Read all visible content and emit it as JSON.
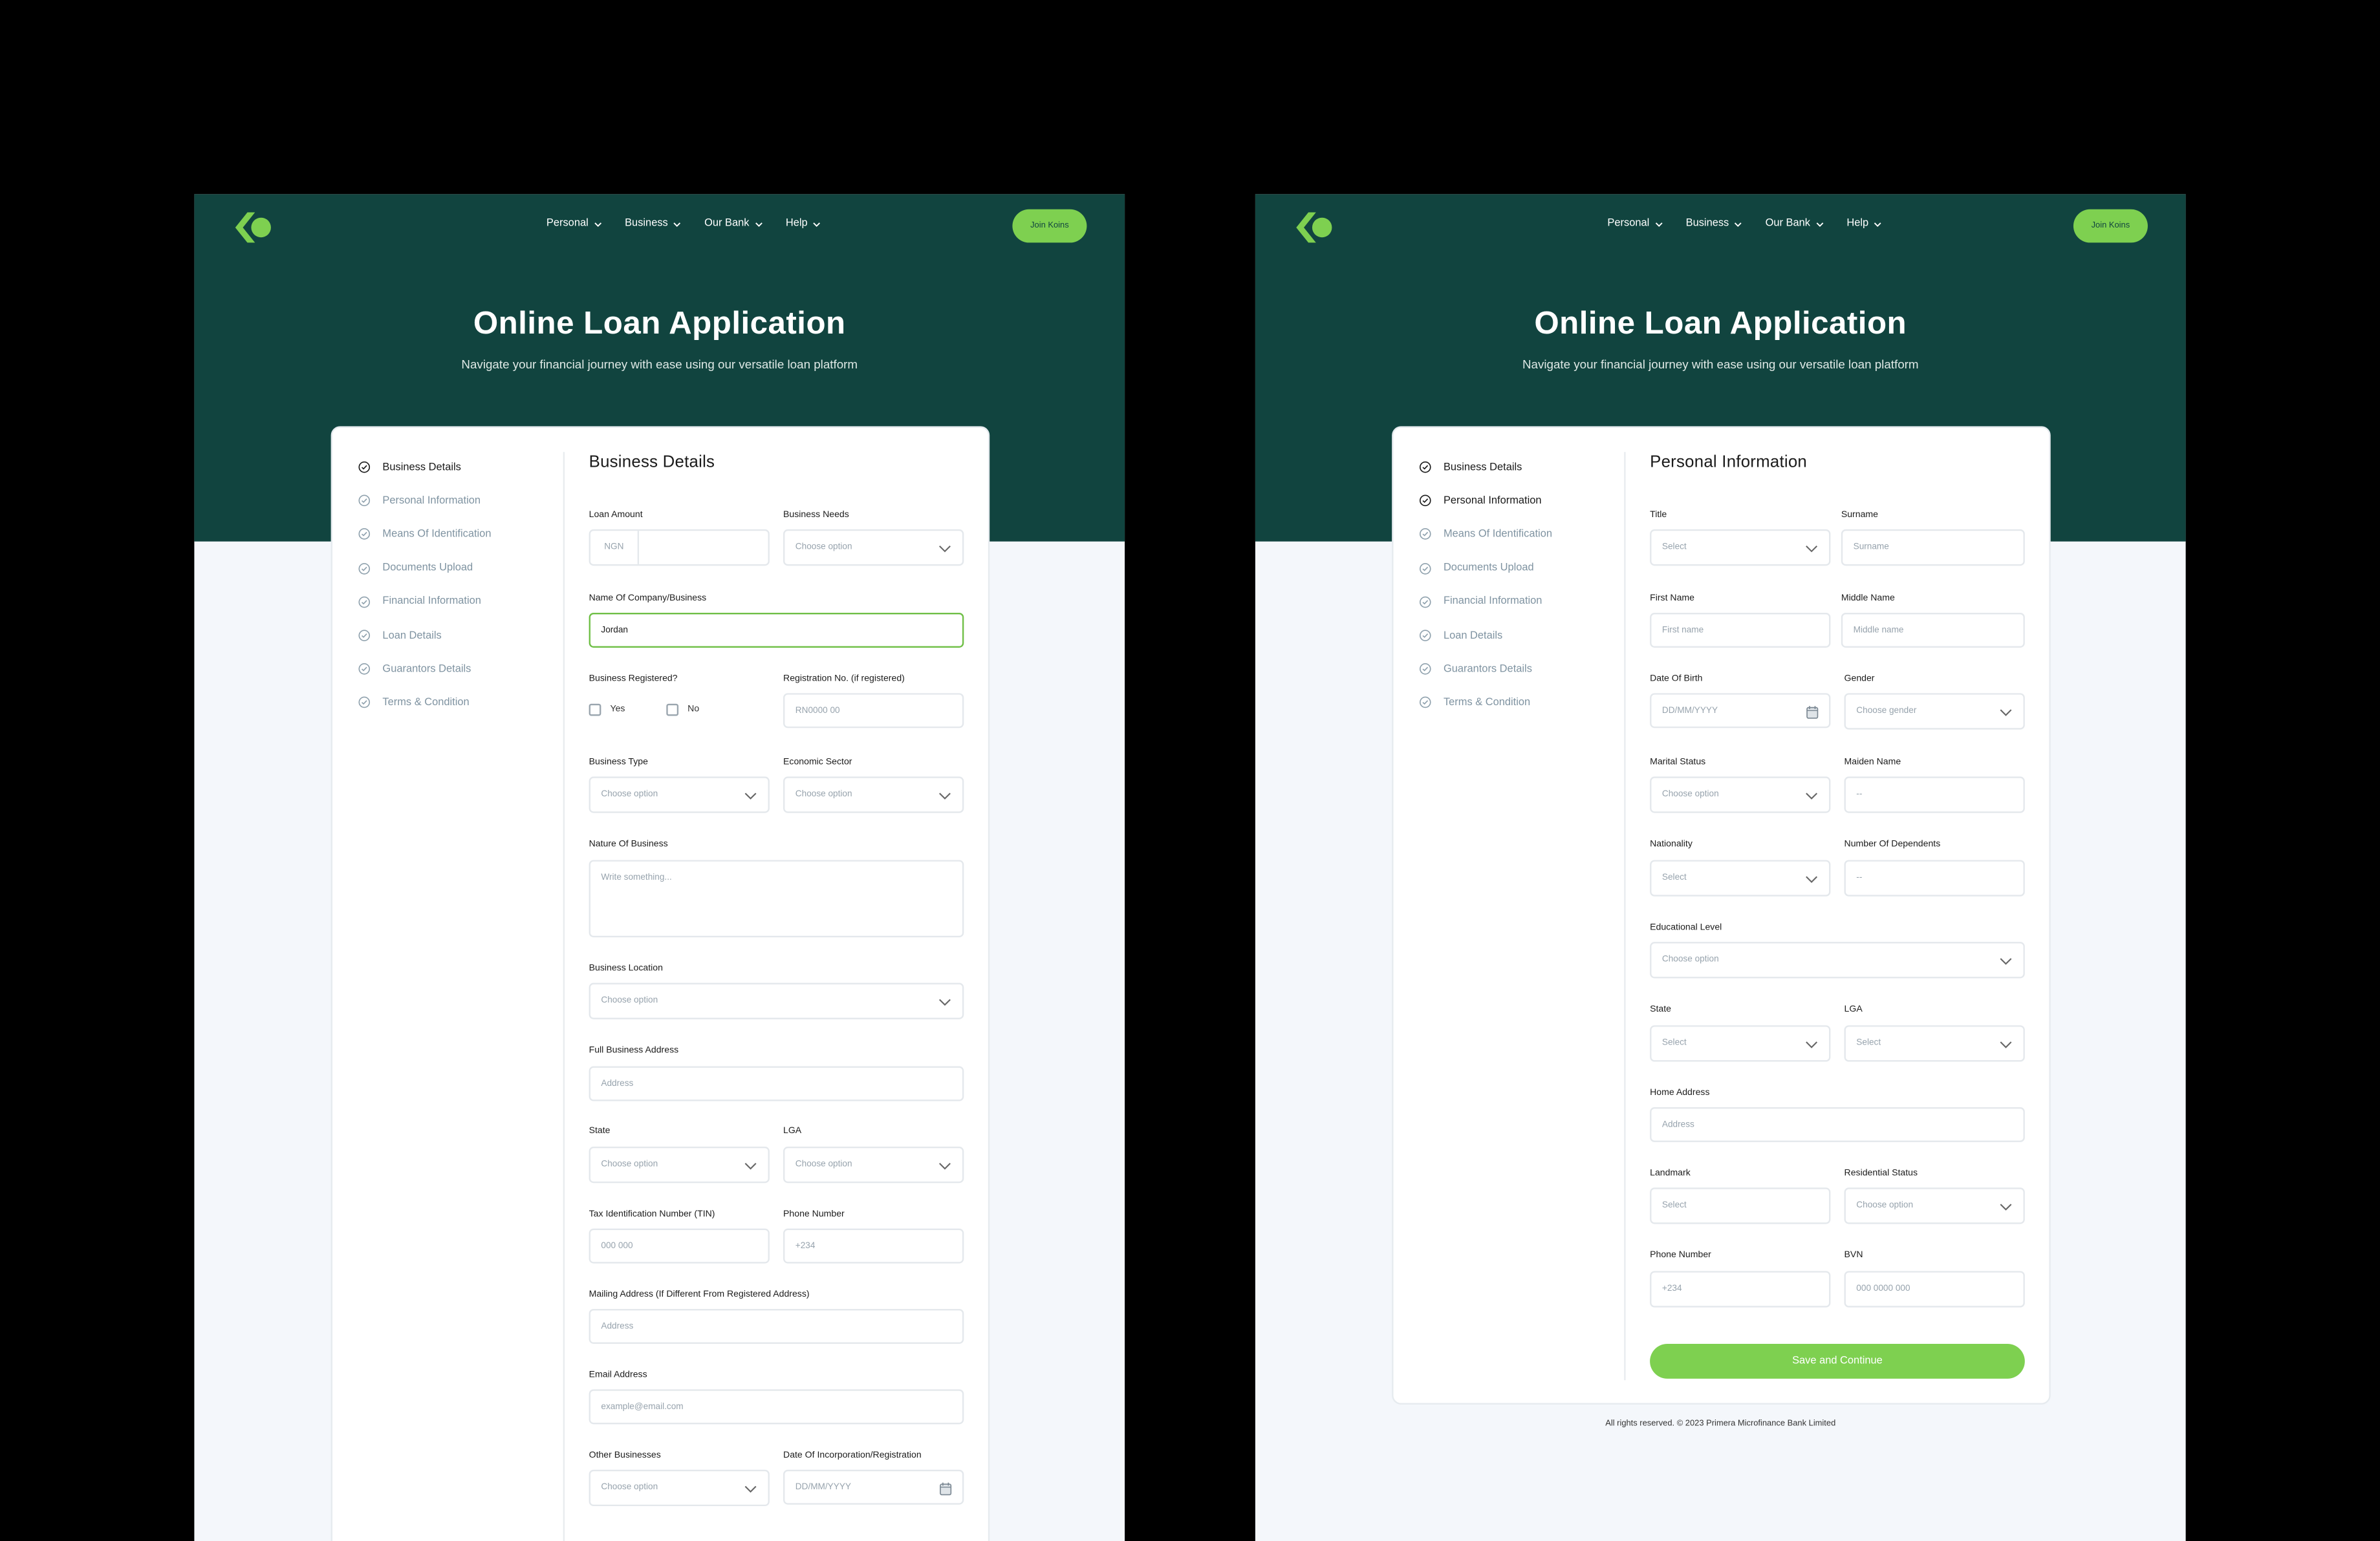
{
  "nav": {
    "items": [
      "Personal",
      "Business",
      "Our Bank",
      "Help"
    ],
    "cta": "Join Koins"
  },
  "hero": {
    "title": "Online Loan Application",
    "subtitle": "Navigate your financial journey with ease using our versatile loan platform"
  },
  "steps": [
    "Business Details",
    "Personal Information",
    "Means Of Identification",
    "Documents Upload",
    "Financial Information",
    "Loan Details",
    "Guarantors Details",
    "Terms & Condition"
  ],
  "colors": {
    "hero_bg": "#11443f",
    "accent": "#7ed050",
    "page_bg": "#f4f7fb"
  },
  "icons": {
    "logo": "koins-logo",
    "check": "check-circle-icon",
    "dropdown": "chevron-down-icon",
    "calendar": "calendar-icon"
  },
  "business_form": {
    "heading": "Business Details",
    "loan_amount": {
      "label": "Loan Amount",
      "prefix": "NGN",
      "value": ""
    },
    "business_needs": {
      "label": "Business Needs",
      "placeholder": "Choose option"
    },
    "company_name": {
      "label": "Name Of Company/Business",
      "value": "Jordan"
    },
    "registered": {
      "label": "Business Registered?",
      "yes": "Yes",
      "no": "No"
    },
    "reg_no": {
      "label": "Registration No. (if registered)",
      "placeholder": "RN0000 00"
    },
    "business_type": {
      "label": "Business Type",
      "placeholder": "Choose option"
    },
    "economic_sector": {
      "label": "Economic Sector",
      "placeholder": "Choose option"
    },
    "nature": {
      "label": "Nature Of Business",
      "placeholder": "Write something..."
    },
    "location": {
      "label": "Business Location",
      "placeholder": "Choose option"
    },
    "address": {
      "label": "Full Business Address",
      "placeholder": "Address"
    },
    "state": {
      "label": "State",
      "placeholder": "Choose option"
    },
    "lga": {
      "label": "LGA",
      "placeholder": "Choose option"
    },
    "tin": {
      "label": "Tax Identification Number (TIN)",
      "placeholder": "000 000"
    },
    "phone": {
      "label": "Phone Number",
      "placeholder": "+234"
    },
    "mailing": {
      "label": "Mailing Address (If Different From Registered Address)",
      "placeholder": "Address"
    },
    "email": {
      "label": "Email Address",
      "placeholder": "example@email.com"
    },
    "other": {
      "label": "Other Businesses",
      "placeholder": "Choose option"
    },
    "inc_date": {
      "label": "Date Of Incorporation/Registration",
      "placeholder": "DD/MM/YYYY"
    }
  },
  "personal_form": {
    "heading": "Personal Information",
    "title": {
      "label": "Title",
      "placeholder": "Select"
    },
    "surname": {
      "label": "Surname",
      "placeholder": "Surname"
    },
    "first_name": {
      "label": "First Name",
      "placeholder": "First name"
    },
    "middle_name": {
      "label": "Middle Name",
      "placeholder": "Middle name"
    },
    "dob": {
      "label": "Date Of Birth",
      "placeholder": "DD/MM/YYYY"
    },
    "gender": {
      "label": "Gender",
      "placeholder": "Choose gender"
    },
    "marital": {
      "label": "Marital Status",
      "placeholder": "Choose option"
    },
    "maiden": {
      "label": "Maiden Name",
      "placeholder": "--"
    },
    "nationality": {
      "label": "Nationality",
      "placeholder": "Select"
    },
    "dependents": {
      "label": "Number Of Dependents",
      "placeholder": "--"
    },
    "education": {
      "label": "Educational Level",
      "placeholder": "Choose option"
    },
    "state": {
      "label": "State",
      "placeholder": "Select"
    },
    "lga": {
      "label": "LGA",
      "placeholder": "Select"
    },
    "home_address": {
      "label": "Home Address",
      "placeholder": "Address"
    },
    "landmark": {
      "label": "Landmark",
      "placeholder": "Select"
    },
    "residential": {
      "label": "Residential Status",
      "placeholder": "Choose option"
    },
    "phone": {
      "label": "Phone Number",
      "placeholder": "+234"
    },
    "bvn": {
      "label": "BVN",
      "placeholder": "000 0000 000"
    },
    "save": "Save and Continue"
  },
  "footer": "All rights reserved. © 2023 Primera Microfinance Bank Limited"
}
